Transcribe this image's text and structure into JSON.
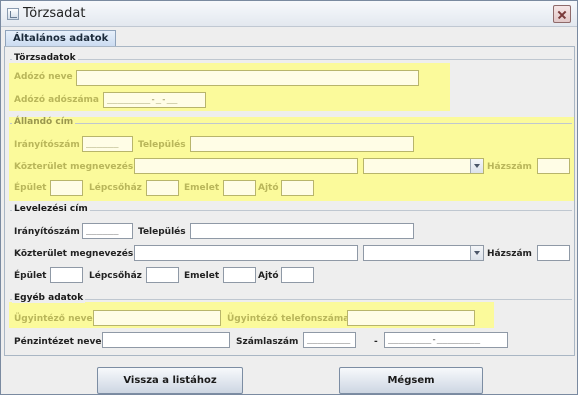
{
  "window": {
    "title": "Törzsadat",
    "icon": "window-icon",
    "close_icon": "close-icon"
  },
  "tabs": [
    {
      "label": "Általános adatok"
    }
  ],
  "torzsadatok": {
    "title": "Törzsadatok",
    "adozo_neve_label": "Adózó neve",
    "adozo_neve_value": "",
    "adoszam_label": "Adózó adószáma",
    "adoszam_value": "________-_-__"
  },
  "allando_cim": {
    "title": "Állandó cím",
    "iranyitoszam_label": "Irányítószám",
    "iranyitoszam_value": "______",
    "telepules_label": "Település",
    "telepules_value": "",
    "kozterulet_label": "Közterület megnevezés",
    "kozterulet_value": "",
    "kozterulet_jelleg_value": "",
    "hazszam_label": "Házszám",
    "hazszam_value": "",
    "epulet_label": "Épület",
    "lepcsohaz_label": "Lépcsőház",
    "emelet_label": "Emelet",
    "ajto_label": "Ajtó"
  },
  "levelezesi_cim": {
    "title": "Levelezési cím",
    "iranyitoszam_label": "Irányítószám",
    "iranyitoszam_value": "______",
    "telepules_label": "Település",
    "telepules_value": "",
    "kozterulet_label": "Közterület megnevezés",
    "kozterulet_value": "",
    "kozterulet_jelleg_value": "",
    "hazszam_label": "Házszám",
    "hazszam_value": "",
    "epulet_label": "Épület",
    "lepcsohaz_label": "Lépcsőház",
    "emelet_label": "Emelet",
    "ajto_label": "Ajtó"
  },
  "egyeb_adatok": {
    "title": "Egyéb adatok",
    "ugyintezo_neve_label": "Ügyintéző neve",
    "ugyintezo_neve_value": "",
    "ugyintezo_tel_label": "Ügyintéző telefonszáma",
    "ugyintezo_tel_value": "",
    "penzintezet_label": "Pénzintézet neve",
    "penzintezet_value": "",
    "szamlaszam_label": "Számlaszám",
    "szamlaszam_part1": "________",
    "szamlaszam_sep": "-",
    "szamlaszam_part2": "________-________"
  },
  "buttons": {
    "back_label": "Vissza a listához",
    "cancel_label": "Mégsem"
  },
  "colors": {
    "highlight": "#fbfa9b",
    "tab_bg": "#c9daf0",
    "window_bg": "#eeeeee"
  }
}
